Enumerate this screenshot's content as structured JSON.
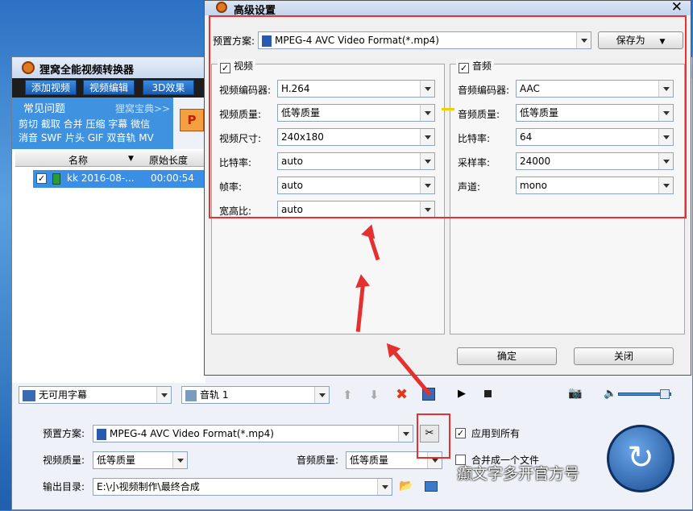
{
  "main": {
    "title": "狸窝全能视频转换器",
    "toolbar": [
      "添加视频",
      "视频编辑",
      "3D效果"
    ],
    "faq": {
      "head": "常见问题",
      "link": "狸窝宝典>>",
      "row1": "剪切 截取 合并 压缩 字幕 微信",
      "row2": "消音 SWF 片头 GIF 双音轨 MV"
    },
    "list": {
      "col_name": "名称",
      "col_len": "原始长度",
      "file_name": "kk 2016-08-...",
      "file_len": "00:00:54"
    }
  },
  "bottom": {
    "subtitle": "无可用字幕",
    "audio_track": "音轨 1",
    "preset_label": "预置方案:",
    "preset_value": "MPEG-4 AVC Video Format(*.mp4)",
    "apply_all": "应用到所有",
    "vq_label": "视频质量:",
    "vq_value": "低等质量",
    "aq_label": "音频质量:",
    "aq_value": "低等质量",
    "merge": "合并成一个文件",
    "out_label": "输出目录:",
    "out_value": "E:\\小视频制作\\最终合成",
    "watermark": "癫文字多开官方号"
  },
  "dialog": {
    "title": "高级设置",
    "preset_label": "预置方案:",
    "preset_value": "MPEG-4 AVC Video Format(*.mp4)",
    "save_as": "保存为",
    "video": {
      "header": "视频",
      "fields": [
        {
          "label": "视频编码器:",
          "value": "H.264"
        },
        {
          "label": "视频质量:",
          "value": "低等质量"
        },
        {
          "label": "视频尺寸:",
          "value": "240x180"
        },
        {
          "label": "比特率:",
          "value": "auto"
        },
        {
          "label": "帧率:",
          "value": "auto"
        },
        {
          "label": "宽高比:",
          "value": "auto"
        }
      ]
    },
    "audio": {
      "header": "音频",
      "fields": [
        {
          "label": "音频编码器:",
          "value": "AAC"
        },
        {
          "label": "音频质量:",
          "value": "低等质量"
        },
        {
          "label": "比特率:",
          "value": "64"
        },
        {
          "label": "采样率:",
          "value": "24000"
        },
        {
          "label": "声道:",
          "value": "mono"
        }
      ]
    },
    "ok": "确定",
    "close": "关闭"
  },
  "colors": {
    "accent": "#3a8ee6",
    "annotation": "#e83030"
  }
}
